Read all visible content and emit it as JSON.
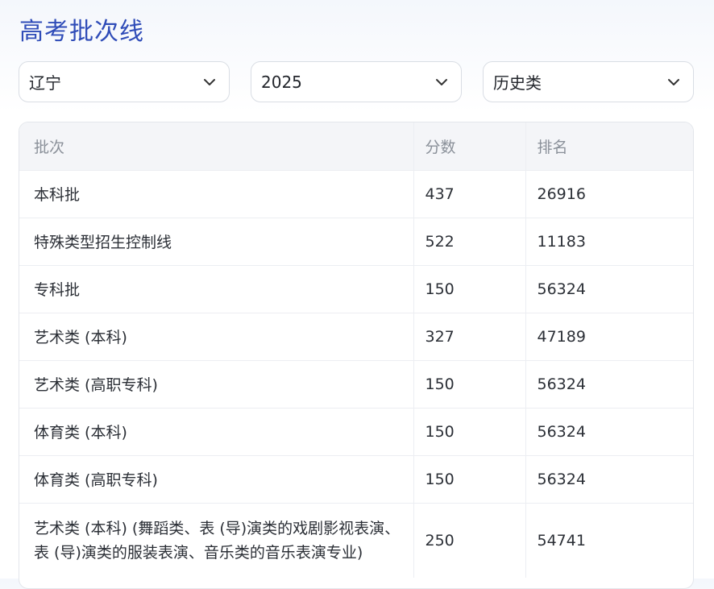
{
  "page_title": "高考批次线",
  "filters": {
    "province": "辽宁",
    "year": "2025",
    "subject_type": "历史类"
  },
  "table": {
    "headers": [
      "批次",
      "分数",
      "排名"
    ],
    "rows": [
      {
        "batch": "本科批",
        "score": "437",
        "rank": "26916"
      },
      {
        "batch": "特殊类型招生控制线",
        "score": "522",
        "rank": "11183"
      },
      {
        "batch": "专科批",
        "score": "150",
        "rank": "56324"
      },
      {
        "batch": "艺术类 (本科)",
        "score": "327",
        "rank": "47189"
      },
      {
        "batch": "艺术类 (高职专科)",
        "score": "150",
        "rank": "56324"
      },
      {
        "batch": "体育类 (本科)",
        "score": "150",
        "rank": "56324"
      },
      {
        "batch": "体育类 (高职专科)",
        "score": "150",
        "rank": "56324"
      },
      {
        "batch": "艺术类 (本科) (舞蹈类、表 (导)演类的戏剧影视表演、表 (导)演类的服装表演、音乐类的音乐表演专业)",
        "score": "250",
        "rank": "54741"
      }
    ]
  }
}
